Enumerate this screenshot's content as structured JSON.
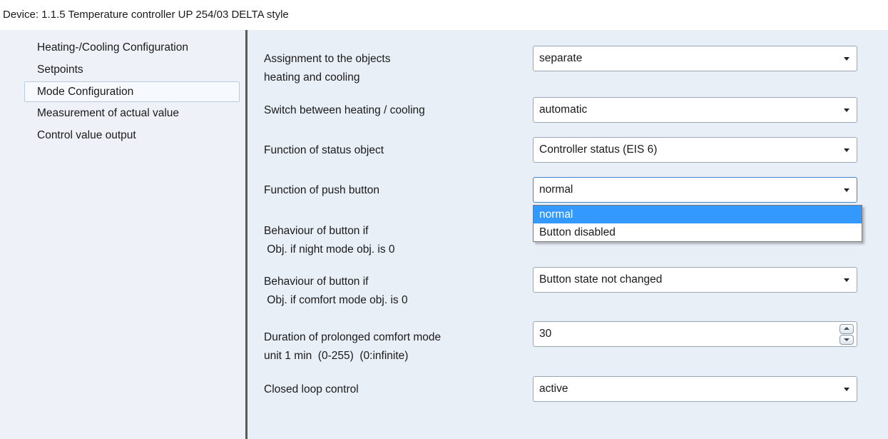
{
  "window": {
    "title": "Device: 1.1.5  Temperature controller UP 254/03 DELTA style"
  },
  "sidebar": {
    "items": [
      {
        "label": "Heating-/Cooling  Configuration"
      },
      {
        "label": "Setpoints"
      },
      {
        "label": "Mode  Configuration",
        "selected": true
      },
      {
        "label": "Measurement of actual value"
      },
      {
        "label": "Control value output"
      }
    ]
  },
  "params": {
    "assignment": {
      "label_line1": "Assignment to the objects",
      "label_line2": "heating and cooling",
      "value": "separate"
    },
    "switch_heating_cooling": {
      "label": "Switch between heating / cooling",
      "value": "automatic"
    },
    "status_object": {
      "label": "Function of status object",
      "value": "Controller status (EIS 6)"
    },
    "push_button": {
      "label": "Function of push button",
      "value": "normal",
      "options": [
        "normal",
        "Button disabled"
      ],
      "highlighted_option": "normal"
    },
    "night_mode": {
      "label_line1": "Behaviour of button if",
      "label_line2": " Obj. if night mode obj. is 0"
    },
    "comfort_mode": {
      "label_line1": "Behaviour of button if",
      "label_line2": " Obj. if comfort mode obj. is 0",
      "value": "Button state not changed"
    },
    "prolonged_comfort": {
      "label_line1": "Duration of prolonged comfort mode",
      "label_line2": "unit 1 min  (0-255)  (0:infinite)",
      "value": "30"
    },
    "closed_loop": {
      "label": "Closed loop control",
      "value": "active"
    }
  },
  "colors": {
    "content_bg": "#e9eff7",
    "sidebar_bg": "#eef2f8",
    "highlight": "#3399ff",
    "focus_border": "#3e84cf"
  }
}
